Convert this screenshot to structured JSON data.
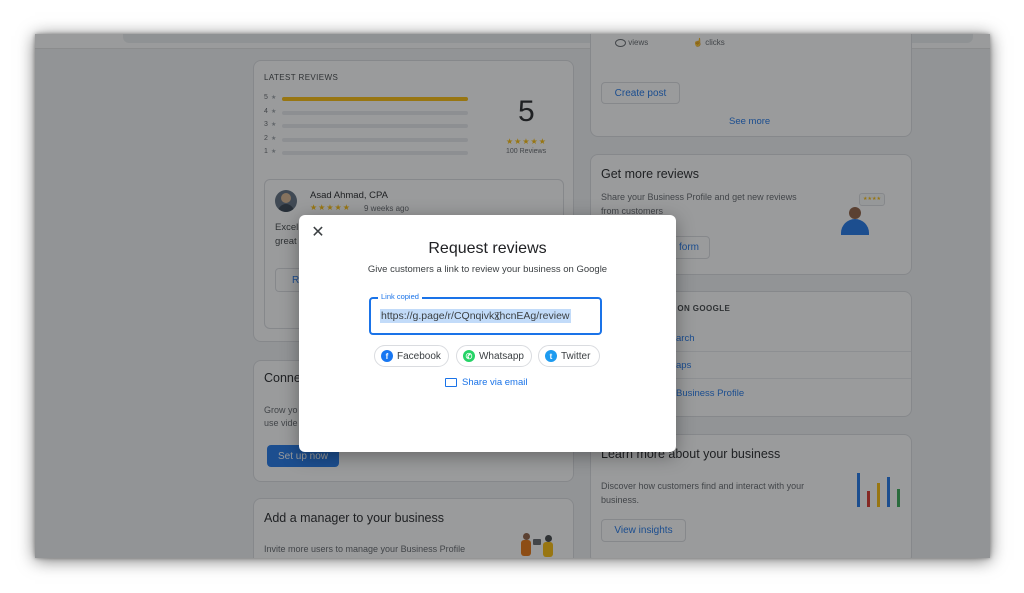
{
  "latest_reviews": {
    "title": "LATEST REVIEWS",
    "rating_rows": [
      {
        "num": "5",
        "fill": 1.0
      },
      {
        "num": "4",
        "fill": 0
      },
      {
        "num": "3",
        "fill": 0
      },
      {
        "num": "2",
        "fill": 0
      },
      {
        "num": "1",
        "fill": 0
      }
    ],
    "average": "5",
    "stars": "★★★★★",
    "count": "100 Reviews",
    "review": {
      "author": "Asad Ahmad, CPA",
      "stars": "★★★★★",
      "time": "9 weeks ago",
      "text_line1": "Excel",
      "text_line2": "great",
      "reply_partial": "R"
    }
  },
  "connect_card": {
    "title_partial": "Conne",
    "desc_line1": "Grow yo",
    "desc_line2": "use vide",
    "button": "Set up now"
  },
  "manager_card": {
    "title": "Add a manager to your business",
    "desc": "Invite more users to manage your Business Profile"
  },
  "right_top": {
    "views_partial": "views",
    "clicks_partial": "clicks",
    "create_post": "Create post",
    "see_more": "See more"
  },
  "get_reviews": {
    "title": "Get more reviews",
    "desc_line1": "Share your Business Profile and get new reviews",
    "desc_line2": "from customers",
    "button_partial": "form"
  },
  "on_google": {
    "title_partial": "S ON GOOGLE",
    "link1": "arch",
    "link2": "aps",
    "link3": "Business Profile"
  },
  "learn_more": {
    "title": "Learn more about your business",
    "desc_line1": "Discover how customers find and interact with your",
    "desc_line2": "business.",
    "button": "View insights"
  },
  "modal": {
    "title": "Request reviews",
    "subtitle": "Give customers a link to review your business on Google",
    "field_label": "Link copied",
    "link": "https://g.page/r/CQnqivkxhcnEAg/review",
    "share": {
      "facebook": "Facebook",
      "whatsapp": "Whatsapp",
      "twitter": "Twitter",
      "email": "Share via email"
    }
  },
  "colors": {
    "accent": "#1a73e8",
    "star": "#fbbc04",
    "facebook": "#1877f2",
    "whatsapp": "#25d366",
    "twitter": "#1d9bf0"
  }
}
